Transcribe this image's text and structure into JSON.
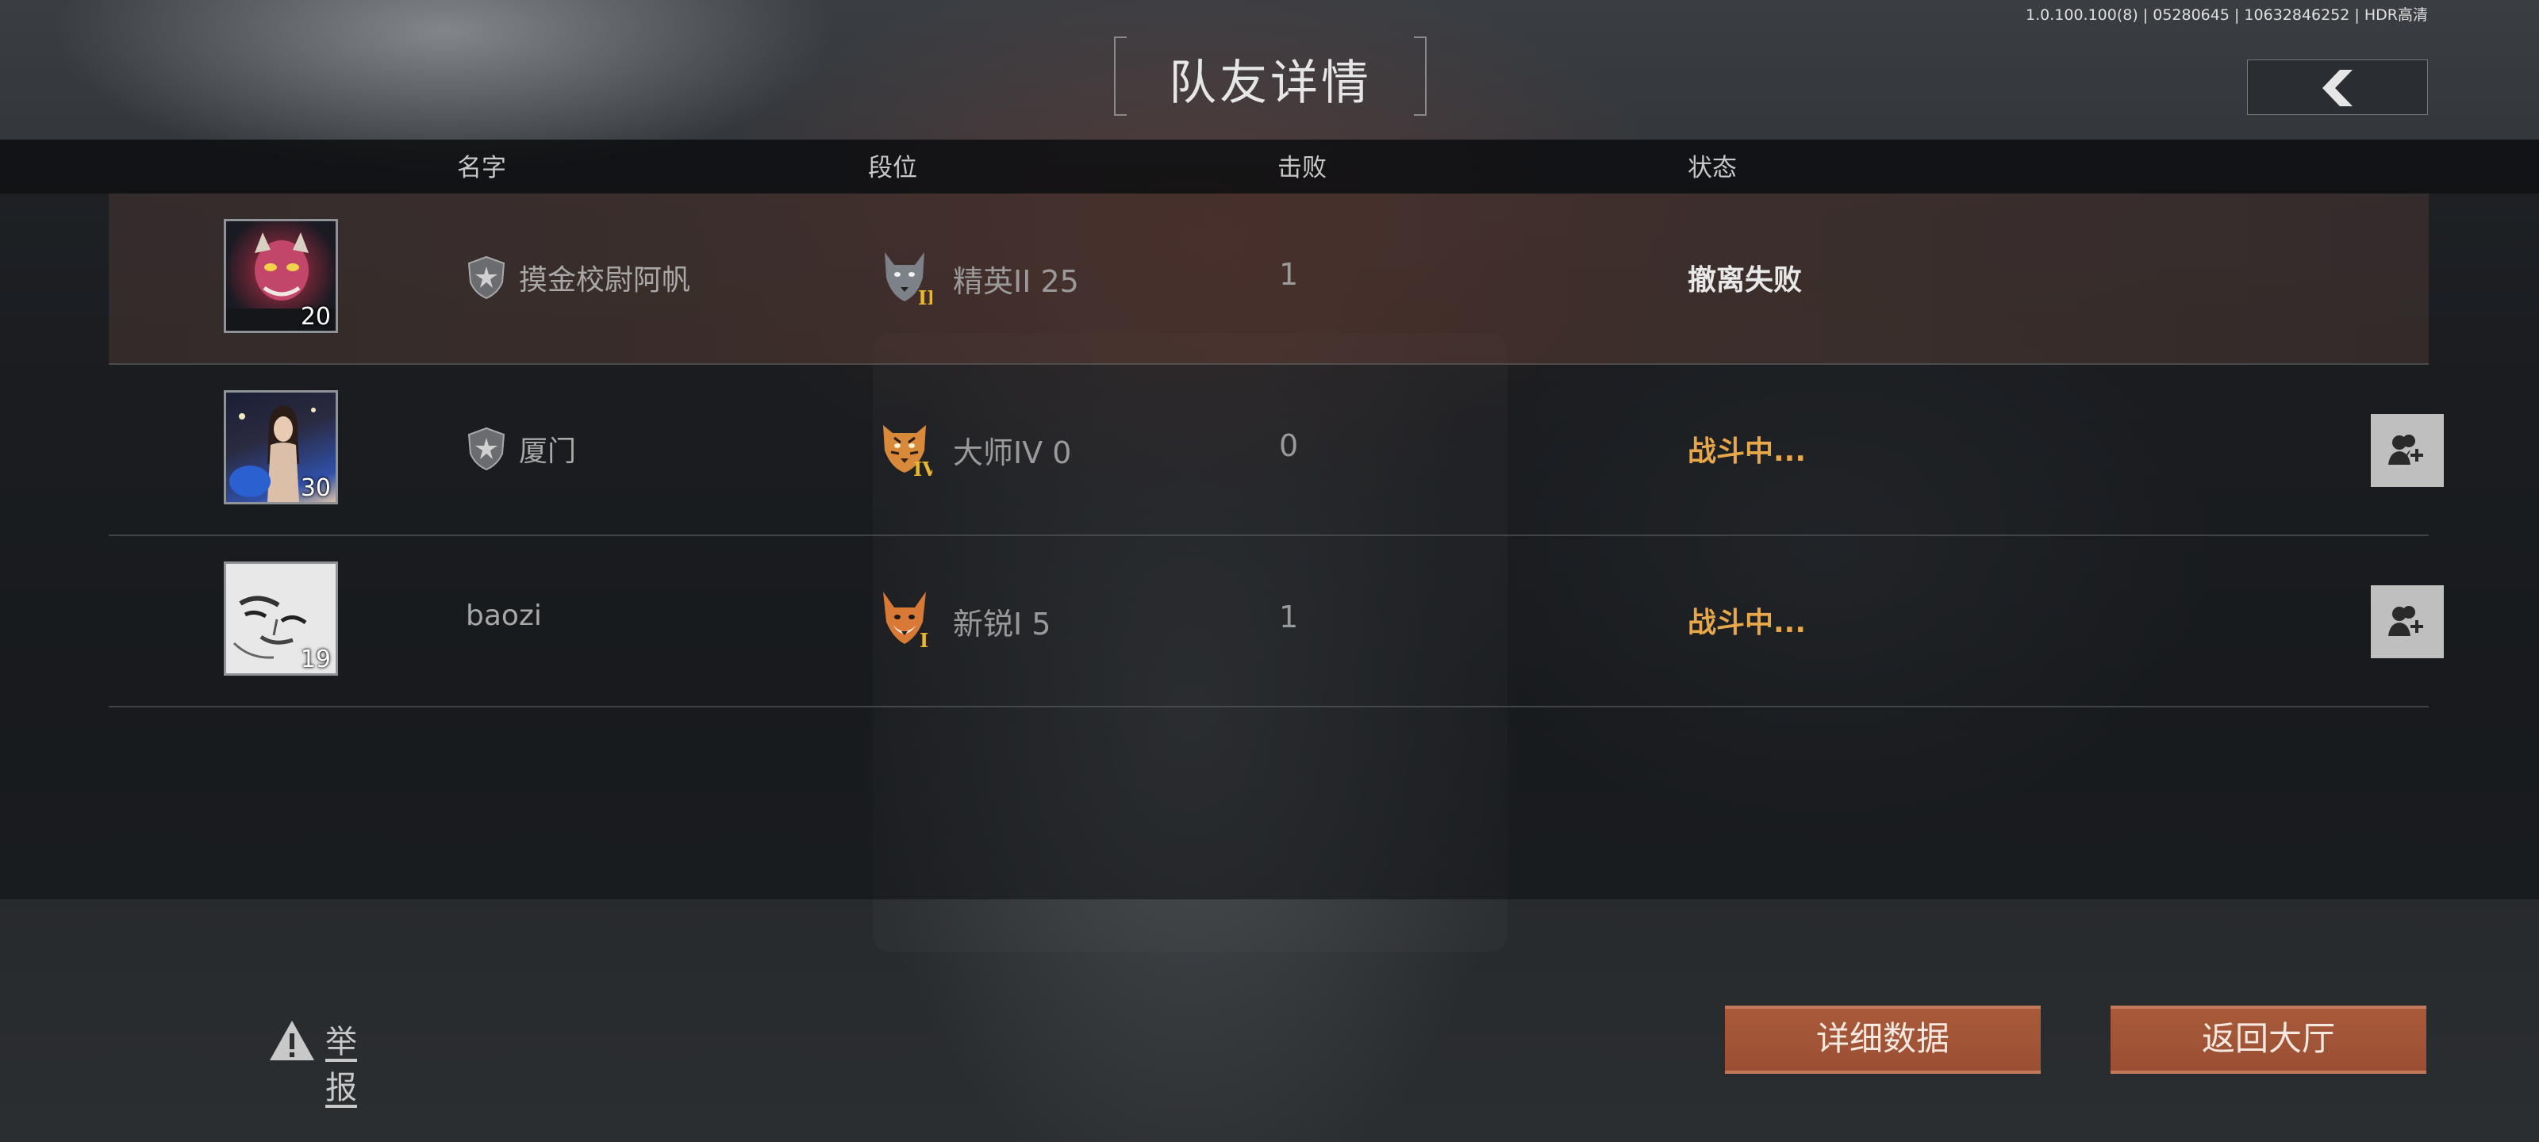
{
  "header": {
    "version_info": "1.0.100.100(8) | 05280645 | 10632846252 | HDR高清",
    "title": "队友详情",
    "back_icon": "chevron-left-icon"
  },
  "columns": {
    "name": "名字",
    "rank": "段位",
    "kills": "击败",
    "status": "状态"
  },
  "teammates": [
    {
      "level": "20",
      "name": "摸金校尉阿帆",
      "has_badge": true,
      "rank_icon": "wolf-rank-icon",
      "rank_tier": "II",
      "rank": "精英II 25",
      "kills": "1",
      "status": "撤离失败",
      "status_color": "#e8e8e8",
      "add_friend": false
    },
    {
      "level": "30",
      "name": "厦门",
      "has_badge": true,
      "rank_icon": "tiger-rank-icon",
      "rank_tier": "IV",
      "rank": "大师IV 0",
      "kills": "0",
      "status": "战斗中...",
      "status_color": "#e8a84a",
      "add_friend": true
    },
    {
      "level": "19",
      "name": "baozi",
      "has_badge": false,
      "rank_icon": "fox-rank-icon",
      "rank_tier": "I",
      "rank": "新锐I 5",
      "kills": "1",
      "status": "战斗中...",
      "status_color": "#e8a84a",
      "add_friend": true
    }
  ],
  "footer": {
    "report": "举报",
    "details_button": "详细数据",
    "lobby_button": "返回大厅"
  },
  "colors": {
    "accent_button": "#a85a3a",
    "in_battle": "#e8a84a"
  }
}
